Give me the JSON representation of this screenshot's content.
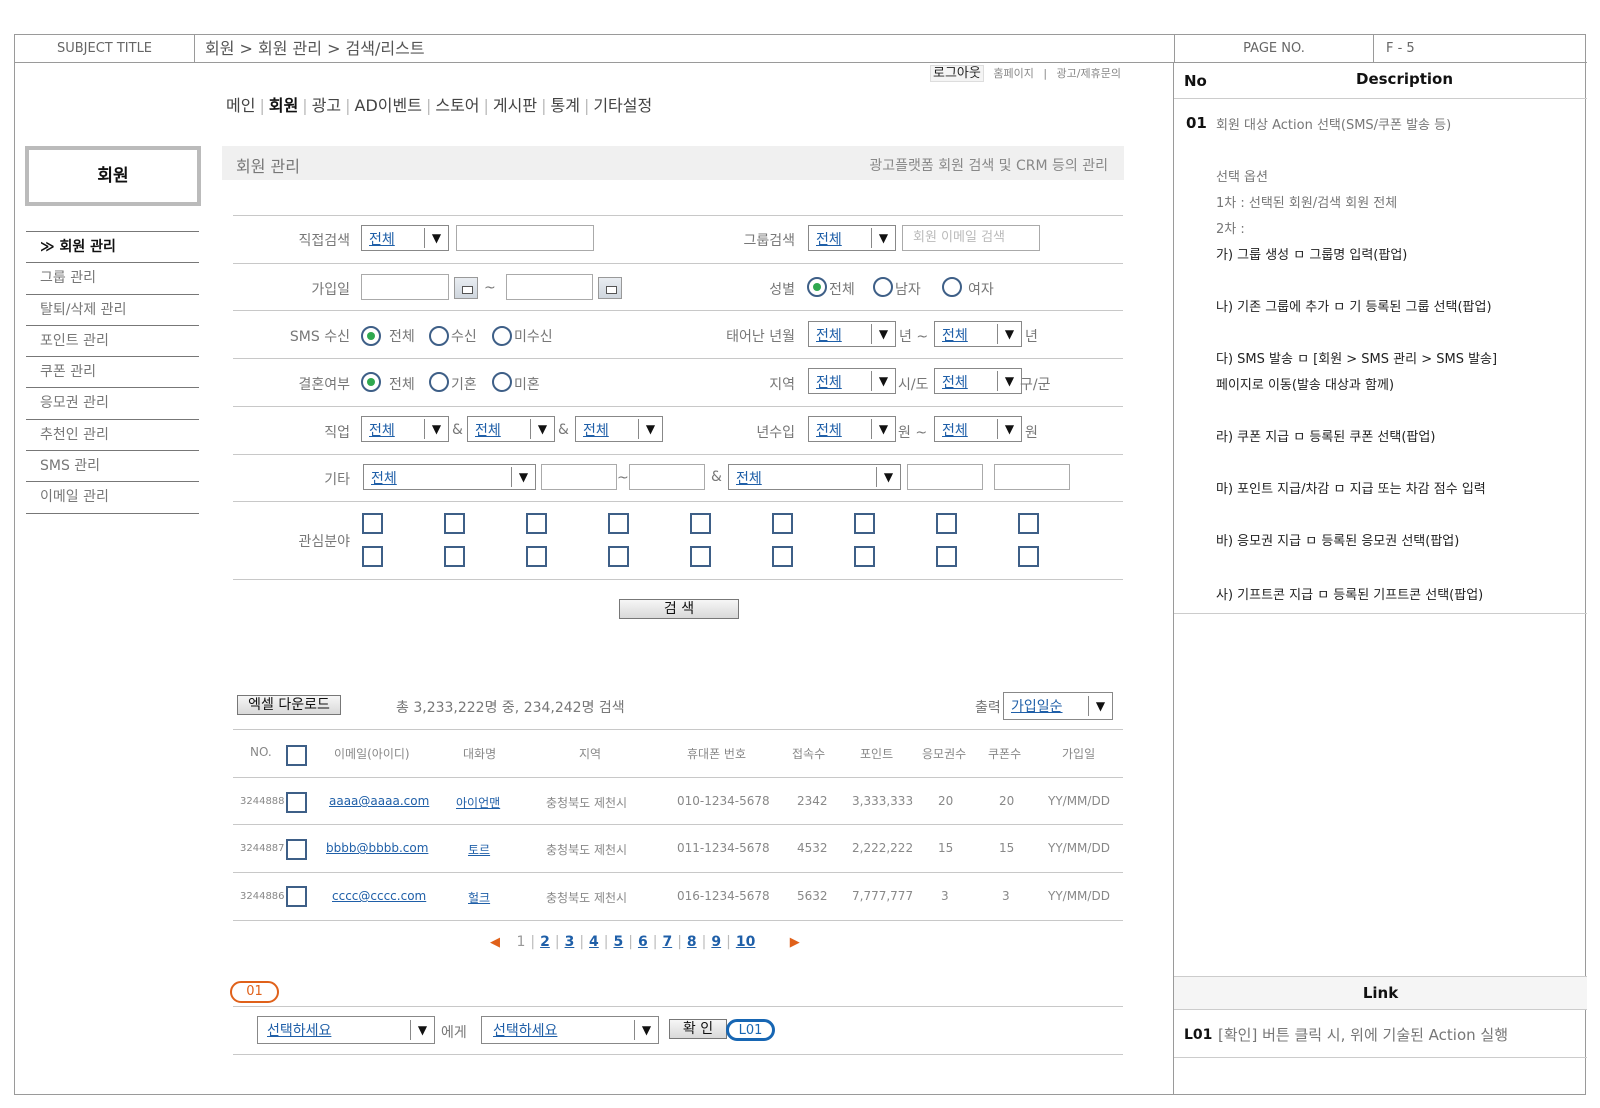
{
  "top_bar": {
    "subject_label": "SUBJECT TITLE",
    "subject_title": "회원 > 회원 관리 > 검색/리스트",
    "page_label": "PAGE NO.",
    "page_no": "F - 5"
  },
  "util_nav": {
    "logout": "로그아웃",
    "home": "홈페이지",
    "sep": "|",
    "contact": "광고/제휴문의"
  },
  "gnb": {
    "items": [
      "메인",
      "회원",
      "광고",
      "AD이벤트",
      "스토어",
      "게시판",
      "통계",
      "기타설정"
    ],
    "active": "회원"
  },
  "sidebar": {
    "title": "회원",
    "items": [
      "≫ 회원 관리",
      "그룹 관리",
      "탈퇴/삭제 관리",
      "포인트 관리",
      "쿠폰 관리",
      "응모권 관리",
      "추천인 관리",
      "SMS 관리",
      "이메일 관리"
    ]
  },
  "section": {
    "title": "회원 관리",
    "desc": "광고플랫폼 회원 검색 및 CRM 등의 관리"
  },
  "form": {
    "direct_search_label": "직접검색",
    "group_search_label": "그룹검색",
    "group_search_placeholder": "회원 이메일 검색",
    "join_date_label": "가입일",
    "tilde": "~",
    "gender_label": "성별",
    "gender_options": [
      "전체",
      "남자",
      "여자"
    ],
    "sms_label": "SMS 수신",
    "sms_options": [
      "전체",
      "수신",
      "미수신"
    ],
    "birth_label": "태어난 년월",
    "year_unit": "년 ~",
    "year_end_unit": "년",
    "marriage_label": "결혼여부",
    "marriage_options": [
      "전체",
      "기혼",
      "미혼"
    ],
    "region_label": "지역",
    "region_unit1": "시/도",
    "region_unit2": "구/군",
    "job_label": "직업",
    "amp": "&",
    "income_label": "년수입",
    "income_unit1": "원 ~",
    "income_unit2": "원",
    "etc_label": "기타",
    "interest_label": "관심분야",
    "all": "전체",
    "search_button": "검 색"
  },
  "results": {
    "excel_button": "엑셀 다운로드",
    "summary": "총 3,233,222명 중, 234,242명 검색",
    "order_label": "출력",
    "order_value": "가입일순",
    "columns": [
      "NO.",
      "이메일(아이디)",
      "대화명",
      "지역",
      "휴대폰 번호",
      "접속수",
      "포인트",
      "응모권수",
      "쿠폰수",
      "가입일"
    ],
    "rows": [
      {
        "no": "3244888",
        "email": "aaaa@aaaa.com",
        "nick": "아이언맨",
        "region": "충청북도 제천시",
        "phone": "010-1234-5678",
        "visits": "2342",
        "points": "3,333,333",
        "tickets": "20",
        "coupons": "20",
        "joined": "YY/MM/DD"
      },
      {
        "no": "3244887",
        "email": "bbbb@bbbb.com",
        "nick": "토르",
        "region": "충청북도 제천시",
        "phone": "011-1234-5678",
        "visits": "4532",
        "points": "2,222,222",
        "tickets": "15",
        "coupons": "15",
        "joined": "YY/MM/DD"
      },
      {
        "no": "3244886",
        "email": "cccc@cccc.com",
        "nick": "헐크",
        "region": "충청북도 제천시",
        "phone": "016-1234-5678",
        "visits": "5632",
        "points": "7,777,777",
        "tickets": "3",
        "coupons": "3",
        "joined": "YY/MM/DD"
      }
    ]
  },
  "pager": {
    "prev": "◀",
    "next": "▶",
    "current": "1",
    "pages": [
      "2",
      "3",
      "4",
      "5",
      "6",
      "7",
      "8",
      "9",
      "10"
    ]
  },
  "action": {
    "tag": "01",
    "select1": "선택하세요",
    "to": "에게",
    "select2": "선택하세요",
    "confirm": "확 인",
    "link_tag": "L01"
  },
  "description": {
    "head_no": "No",
    "head_desc": "Description",
    "item_no": "01",
    "lines": [
      "회원 대상 Action 선택(SMS/쿠폰 발송 등)",
      "선택 옵션",
      "1차 : 선택된 회원/검색 회원 전체",
      "2차 :",
      "가) 그룹 생성 ㅁ 그룹명 입력(팝업)",
      "나) 기존 그룹에 추가 ㅁ 기 등록된 그룹 선택(팝업)",
      "다) SMS 발송 ㅁ [회원 > SMS 관리 > SMS 발송]",
      "페이지로 이동(발송 대상과 함께)",
      "라) 쿠폰 지급 ㅁ 등록된 쿠폰 선택(팝업)",
      "마) 포인트 지급/차감 ㅁ 지급 또는 차감 점수 입력",
      "바) 응모권 지급 ㅁ 등록된 응모권 선택(팝업)",
      "사) 기프트콘 지급 ㅁ 등록된 기프트콘 선택(팝업)"
    ]
  },
  "link": {
    "head": "Link",
    "id": "L01",
    "text": "[확인] 버튼 클릭 시, 위에 기술된 Action 실행"
  },
  "colors": {
    "accent_orange": "#e0611a",
    "accent_blue": "#1766b3",
    "link_blue": "#1f5fa8"
  }
}
